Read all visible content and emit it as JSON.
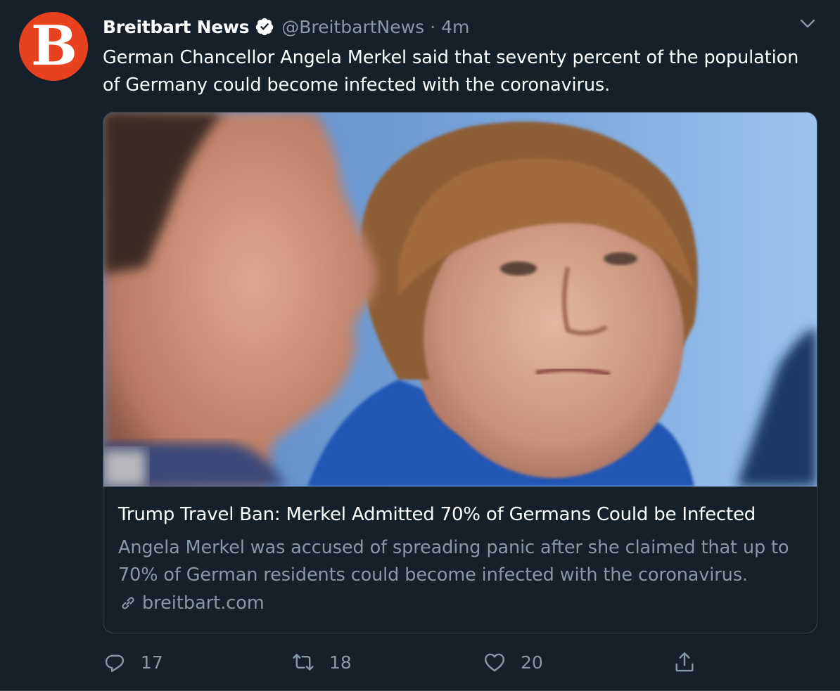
{
  "tweet": {
    "author": {
      "display_name": "Breitbart News",
      "handle": "@BreitbartNews",
      "avatar_letter": "B",
      "verified": true
    },
    "separator": "·",
    "time": "4m",
    "text": "German Chancellor Angela Merkel said that seventy percent of the population of Germany could become infected with the coronavirus.",
    "card": {
      "title": "Trump Travel Ban: Merkel Admitted 70% of Germans Could be Infected",
      "description": "Angela Merkel was accused of spreading panic after she claimed that up to 70% of German residents could become infected with the coronavirus.",
      "domain": "breitbart.com",
      "image_alt": "photo of two people at a press conference, woman in blue jacket looking sideways, man in foreground out of focus"
    },
    "actions": {
      "reply_count": "17",
      "retweet_count": "18",
      "like_count": "20"
    }
  },
  "icons": {
    "verified": "verified-badge-icon",
    "more": "chevron-down-icon",
    "link": "link-icon",
    "reply": "reply-icon",
    "retweet": "retweet-icon",
    "like": "heart-icon",
    "share": "share-icon"
  },
  "colors": {
    "background": "#15202b",
    "border": "#38444d",
    "text_primary": "#ffffff",
    "text_secondary": "#8899a6",
    "brand_orange": "#e7411f"
  }
}
